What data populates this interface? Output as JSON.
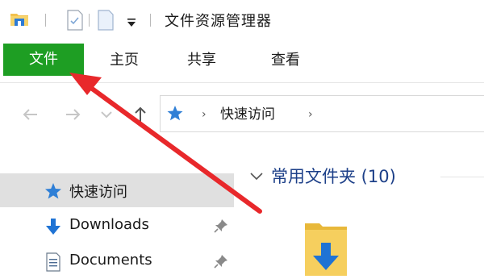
{
  "window": {
    "title": "文件资源管理器"
  },
  "ribbon": {
    "tabs": [
      {
        "label": "文件",
        "active": true
      },
      {
        "label": "主页"
      },
      {
        "label": "共享"
      },
      {
        "label": "查看"
      }
    ],
    "file_tab_color": "#1e9e23"
  },
  "address_bar": {
    "path": [
      "快速访问"
    ],
    "icon": "star-icon"
  },
  "nav_pane": {
    "items": [
      {
        "label": "快速访问",
        "icon": "star-icon",
        "selected": true
      },
      {
        "label": "Downloads",
        "icon": "download-icon",
        "pinned": true
      },
      {
        "label": "Documents",
        "icon": "document-icon",
        "pinned": true
      }
    ]
  },
  "content": {
    "group_title": "常用文件夹 (10)"
  },
  "annotation": {
    "color": "#e8282b",
    "icon": "red-arrow"
  }
}
